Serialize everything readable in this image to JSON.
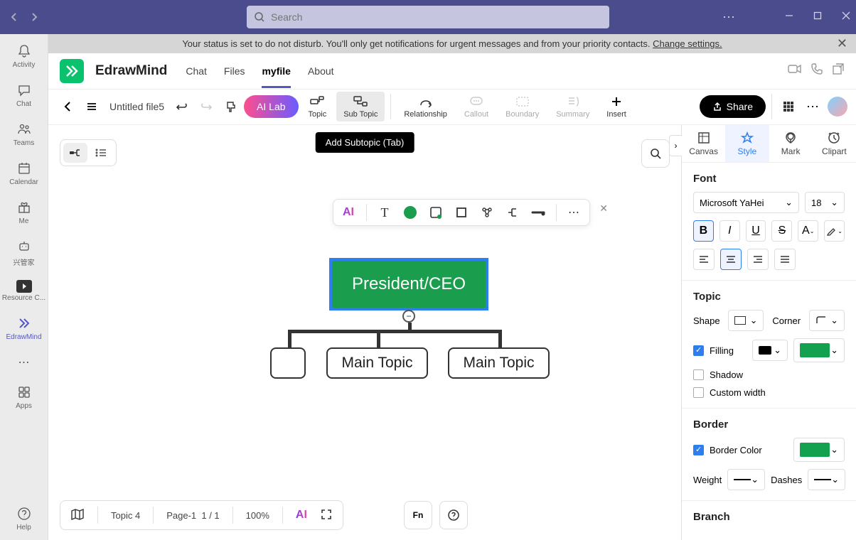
{
  "titlebar": {
    "search_placeholder": "Search"
  },
  "left_rail": {
    "items": [
      {
        "label": "Activity"
      },
      {
        "label": "Chat"
      },
      {
        "label": "Teams"
      },
      {
        "label": "Calendar"
      },
      {
        "label": "Me"
      },
      {
        "label": "兴管家"
      },
      {
        "label": "Resource C..."
      },
      {
        "label": "EdrawMind"
      }
    ],
    "more": "",
    "apps": "Apps",
    "help": "Help"
  },
  "notif": {
    "text": "Your status is set to do not disturb. You'll only get notifications for urgent messages and from your priority contacts. ",
    "link": "Change settings."
  },
  "app": {
    "name": "EdrawMind",
    "tabs": [
      "Chat",
      "Files",
      "myfile",
      "About"
    ],
    "active": 2
  },
  "toolbar": {
    "filename": "Untitled file5",
    "ai_lab": "AI Lab",
    "items": [
      {
        "label": "Topic"
      },
      {
        "label": "Sub Topic"
      },
      {
        "label": "Relationship"
      },
      {
        "label": "Callout"
      },
      {
        "label": "Boundary"
      },
      {
        "label": "Summary"
      },
      {
        "label": "Insert"
      }
    ],
    "share": "Share"
  },
  "tooltip": "Add Subtopic (Tab)",
  "nodes": {
    "root": "President/CEO",
    "sub1": "",
    "sub2": "Main Topic",
    "sub3": "Main Topic"
  },
  "panel": {
    "tabs": [
      "Canvas",
      "Style",
      "Mark",
      "Clipart"
    ],
    "active": 1,
    "font": {
      "title": "Font",
      "family": "Microsoft YaHei",
      "size": "18"
    },
    "topic": {
      "title": "Topic",
      "shape": "Shape",
      "corner": "Corner",
      "filling": "Filling",
      "shadow": "Shadow",
      "custom_width": "Custom width"
    },
    "border": {
      "title": "Border",
      "color": "Border Color",
      "weight": "Weight",
      "dashes": "Dashes"
    },
    "branch": {
      "title": "Branch"
    },
    "colors": {
      "fill": "#13a04f",
      "border": "#13a04f",
      "text": "#000000"
    }
  },
  "bottom": {
    "topic": "Topic 4",
    "page": "Page-1",
    "pages": "1 / 1",
    "zoom": "100%"
  }
}
